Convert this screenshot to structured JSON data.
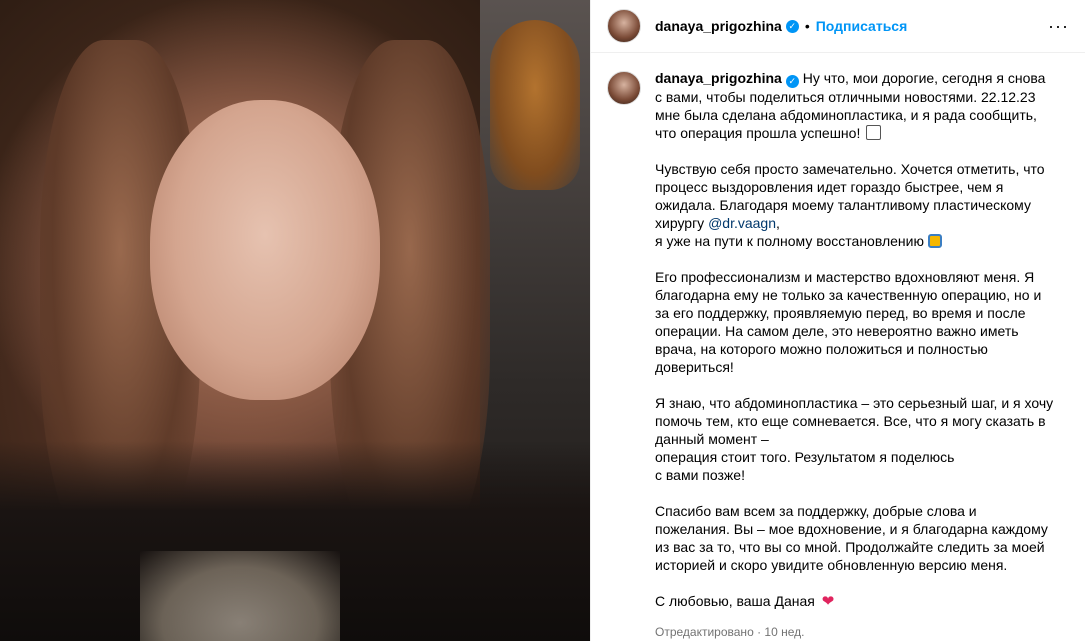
{
  "post": {
    "username": "danaya_prigozhina",
    "dot": "•",
    "follow_label": "Подписаться",
    "more": "···"
  },
  "caption": {
    "p1_before": "Ну что, мои дорогие, сегодня я снова с вами, чтобы поделиться отличными новостями. 22.12.23 мне была сделана абдоминопластика, и я рада сообщить, что операция прошла успешно!",
    "p2_before": "Чувствую себя просто замечательно. Хочется отметить, что процесс выздоровления идет гораздо быстрее, чем я ожидала. Благодаря моему талантливому пластическому хирургу",
    "mention": "@dr.vaagn",
    "p2_after": ",\nя уже на пути к полному восстановлению",
    "p3": "Его профессионализм и мастерство вдохновляют меня. Я благодарна ему не только за качественную операцию, но и за его поддержку, проявляемую перед, во время и после операции. На самом деле, это невероятно важно иметь врача, на которого можно положиться и полностью довериться!",
    "p4": "Я знаю, что абдоминопластика – это серьезный шаг, и я хочу помочь тем, кто еще сомневается. Все, что я могу сказать в данный момент –\nоперация стоит того. Результатом я поделюсь\nс вами позже!",
    "p5": "Спасибо вам всем за поддержку, добрые слова и пожелания. Вы – мое вдохновение, и я благодарна каждому из вас за то, что вы со мной. Продолжайте следить за моей историей и скоро увидите обновленную версию меня.",
    "p6": "С любовью, ваша Даная",
    "heart": "❤"
  },
  "meta": {
    "edited": "Отредактировано",
    "sep": " · ",
    "time": "10 нед."
  },
  "icons": {
    "verified": "✓"
  }
}
